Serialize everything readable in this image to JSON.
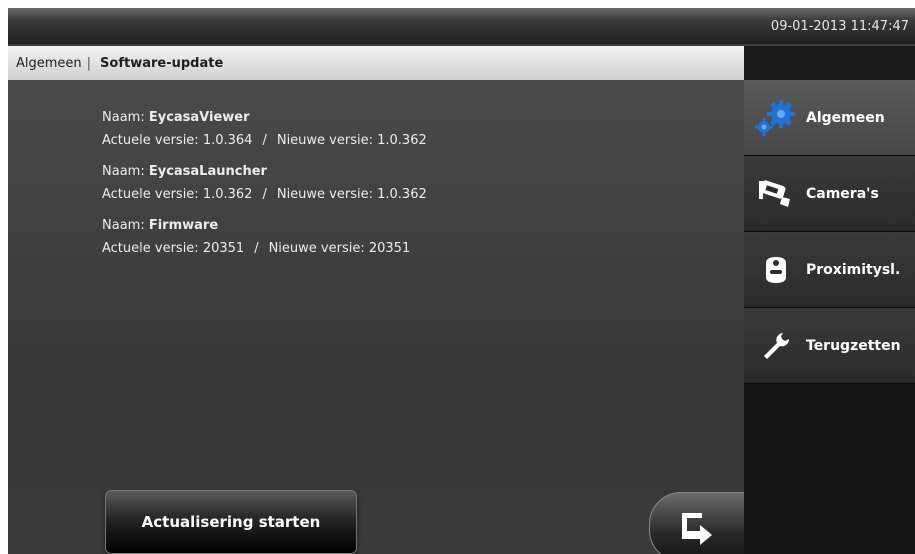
{
  "header": {
    "datetime": "09-01-2013 11:47:47"
  },
  "breadcrumb": {
    "parent": "Algemeen",
    "separator": "|",
    "current": "Software-update"
  },
  "labels": {
    "name": "Naam:",
    "current_version": "Actuele versie:",
    "new_version": "Nieuwe versie:",
    "separator": "/"
  },
  "updates": [
    {
      "name": "EycasaViewer",
      "current": "1.0.364",
      "new": "1.0.362"
    },
    {
      "name": "EycasaLauncher",
      "current": "1.0.362",
      "new": "1.0.362"
    },
    {
      "name": "Firmware",
      "current": "20351",
      "new": "20351"
    }
  ],
  "actions": {
    "start_update": "Actualisering starten"
  },
  "sidebar": {
    "items": [
      {
        "label": "Algemeen",
        "icon": "gears-icon",
        "active": true
      },
      {
        "label": "Camera's",
        "icon": "camera-icon",
        "active": false
      },
      {
        "label": "Proximitysl.",
        "icon": "tag-icon",
        "active": false
      },
      {
        "label": "Terugzetten",
        "icon": "wrench-icon",
        "active": false
      }
    ]
  },
  "colors": {
    "accent_blue": "#1e73d8",
    "background": "#3c3c3c",
    "sidebar": "#141414"
  }
}
